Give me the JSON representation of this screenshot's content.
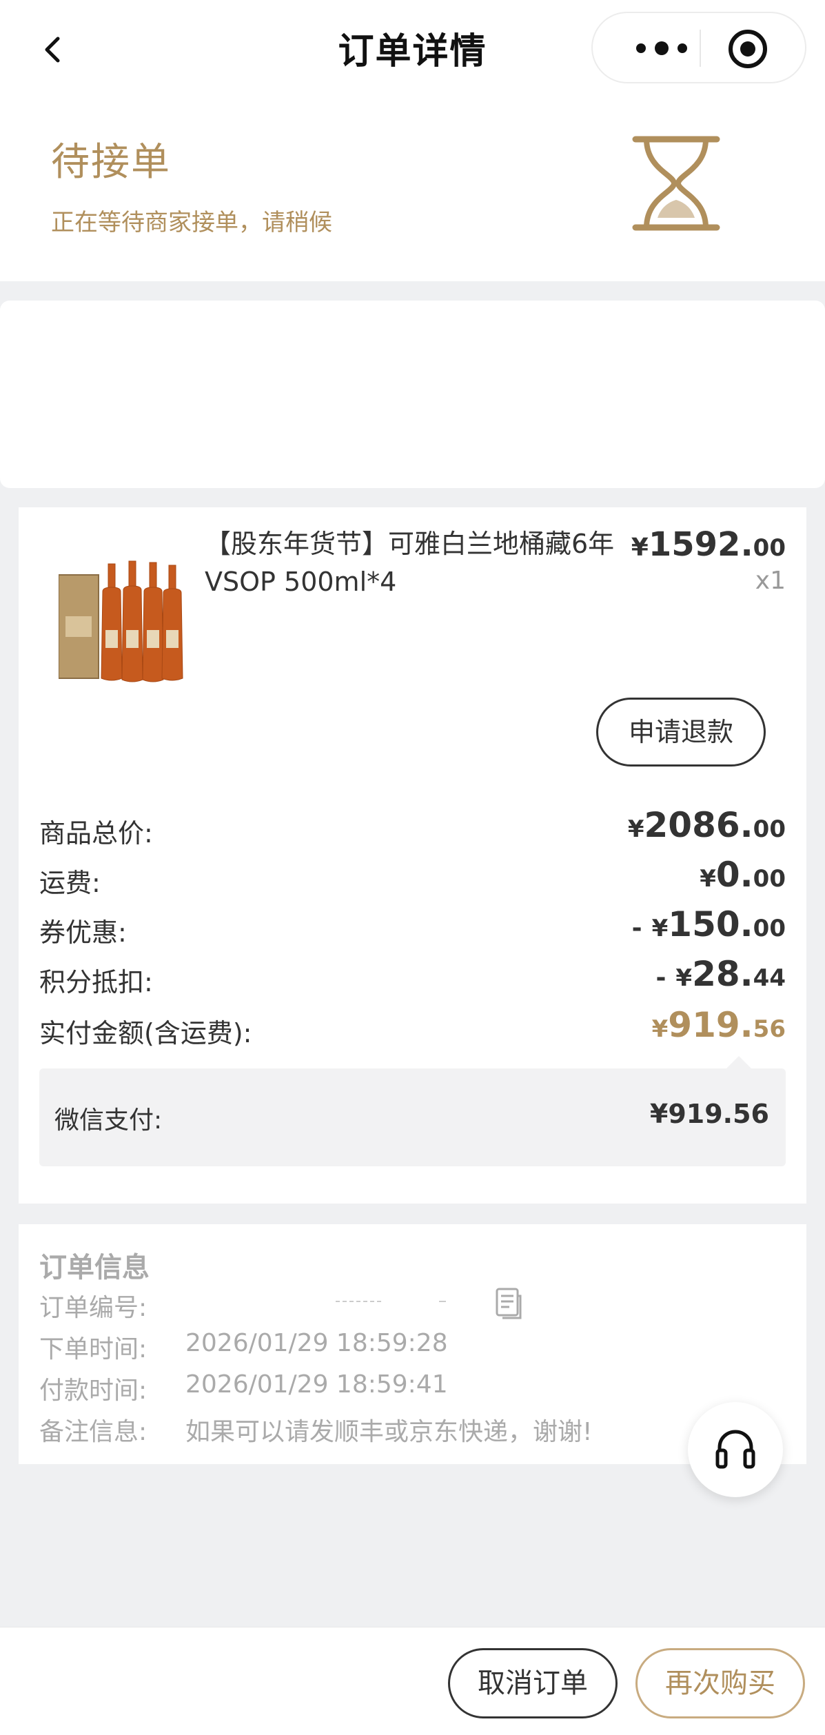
{
  "nav": {
    "title": "订单详情",
    "back_icon": "chevron-left-icon",
    "more_icon": "more-dots-icon",
    "close_icon": "target-close-icon"
  },
  "status": {
    "title": "待接单",
    "description": "正在等待商家接单，请稍候",
    "icon": "hourglass-icon",
    "color": "#b08f5c"
  },
  "product": {
    "name": "【股东年货节】可雅白兰地桶藏6年VSOP 500ml*4",
    "price_symbol": "¥",
    "price_int": "1592.",
    "price_dec": "00",
    "quantity": "x1",
    "refund_label": "申请退款"
  },
  "fees": [
    {
      "label": "商品总价:",
      "minus": "",
      "symbol": "¥",
      "int": "2086.",
      "dec": "00"
    },
    {
      "label": "运费:",
      "minus": "",
      "symbol": "¥",
      "int": "0.",
      "dec": "00"
    },
    {
      "label": "券优惠:",
      "minus": "-",
      "symbol": "¥",
      "int": "150.",
      "dec": "00"
    },
    {
      "label": "积分抵扣:",
      "minus": "-",
      "symbol": "¥",
      "int": "28.",
      "dec": "44"
    },
    {
      "label": "实付金额(含运费):",
      "minus": "",
      "symbol": "¥",
      "int": "919.",
      "dec": "56"
    }
  ],
  "payment": {
    "label": "微信支付:",
    "value": "¥919.56"
  },
  "order_info": {
    "title": "订单信息",
    "rows": [
      {
        "label": "订单编号:",
        "value": ""
      },
      {
        "label": "下单时间:",
        "value": "2026/01/29 18:59:28"
      },
      {
        "label": "付款时间:",
        "value": "2026/01/29 18:59:41"
      },
      {
        "label": "备注信息:",
        "value": "如果可以请发顺丰或京东快递，谢谢!"
      }
    ]
  },
  "service_icon": "headset-icon",
  "bottom": {
    "cancel_label": "取消订单",
    "rebuy_label": "再次购买"
  },
  "colors": {
    "accent": "#b08f5c",
    "background": "#eff0f2"
  }
}
